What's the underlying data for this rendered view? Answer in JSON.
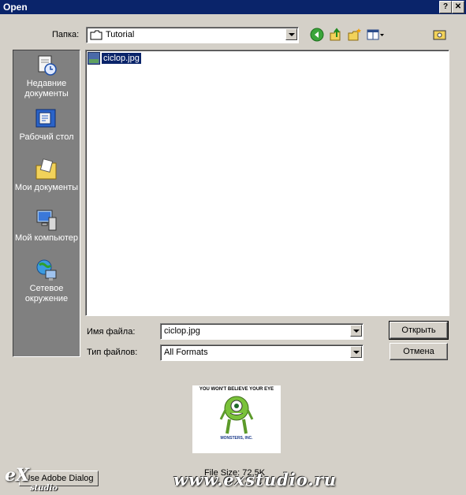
{
  "window": {
    "title": "Open",
    "help_label": "?",
    "close_label": "✕"
  },
  "lookin": {
    "label": "Папка:",
    "value": "Tutorial"
  },
  "toolbar": {
    "icons": [
      "back-icon",
      "up-folder-icon",
      "new-folder-icon",
      "view-menu-icon",
      "extra-folder-icon"
    ]
  },
  "places": [
    {
      "label": "Недавние документы",
      "icon": "recent-documents-icon"
    },
    {
      "label": "Рабочий стол",
      "icon": "desktop-icon"
    },
    {
      "label": "Мои документы",
      "icon": "my-documents-icon"
    },
    {
      "label": "Мой компьютер",
      "icon": "my-computer-icon"
    },
    {
      "label": "Сетевое окружение",
      "icon": "network-icon"
    }
  ],
  "files": [
    {
      "name": "ciclop.jpg",
      "icon_text": "JPG",
      "selected": true
    }
  ],
  "filename": {
    "label": "Имя файла:",
    "value": "ciclop.jpg"
  },
  "filetype": {
    "label": "Тип файлов:",
    "value": "All Formats"
  },
  "buttons": {
    "open": "Открыть",
    "cancel": "Отмена"
  },
  "preview": {
    "headline": "YOU WON'T BELIEVE YOUR EYE",
    "title": "MONSTERS, INC.",
    "file_size": "File Size: 72,5K"
  },
  "adobe_button": "Use Adobe Dialog",
  "watermark": {
    "logo": "eX",
    "studio": "studio",
    "url": "www.exstudio.ru"
  },
  "colors": {
    "titlebar": "#0a246a",
    "face": "#d4d0c8",
    "places_bg": "#808080",
    "selection": "#0a246a"
  }
}
